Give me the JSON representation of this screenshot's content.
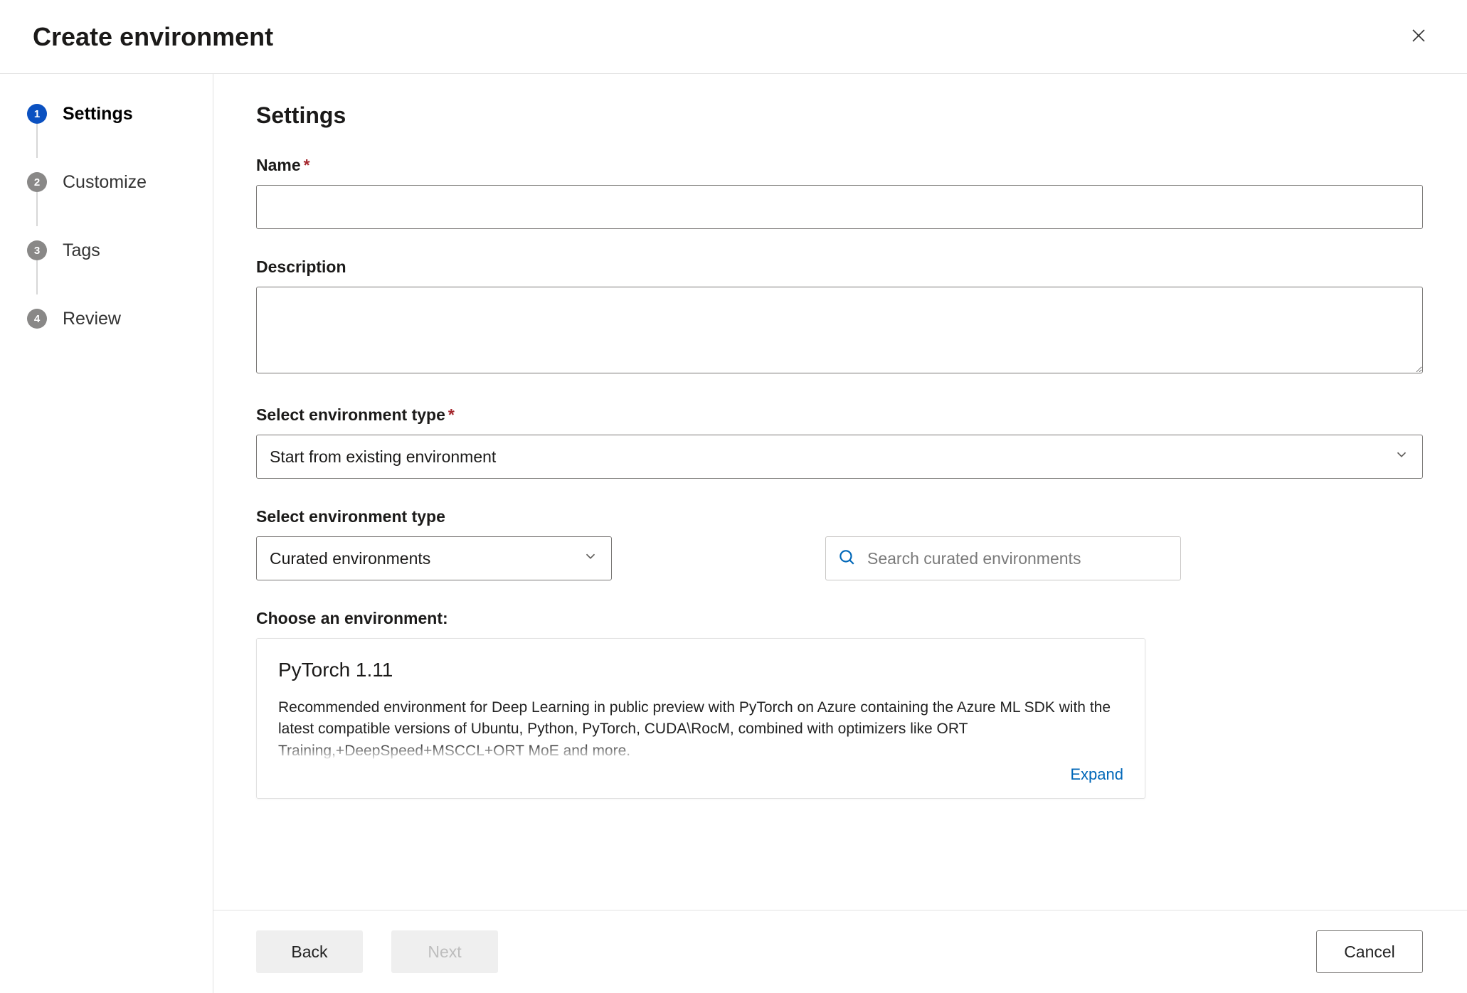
{
  "header": {
    "title": "Create environment"
  },
  "steps": [
    {
      "num": "1",
      "label": "Settings",
      "active": true
    },
    {
      "num": "2",
      "label": "Customize",
      "active": false
    },
    {
      "num": "3",
      "label": "Tags",
      "active": false
    },
    {
      "num": "4",
      "label": "Review",
      "active": false
    }
  ],
  "main": {
    "heading": "Settings",
    "name_label": "Name",
    "name_value": "",
    "desc_label": "Description",
    "desc_value": "",
    "env_type_label": "Select environment type",
    "env_type_value": "Start from existing environment",
    "env_type2_label": "Select environment type",
    "env_type2_value": "Curated environments",
    "search_placeholder": "Search curated environments",
    "choose_label": "Choose an environment:",
    "card": {
      "title": "PyTorch 1.11",
      "desc": "Recommended environment for Deep Learning in public preview with PyTorch on Azure containing the Azure ML SDK with the latest compatible versions of Ubuntu, Python, PyTorch, CUDA\\RocM, combined with optimizers like ORT Training,+DeepSpeed+MSCCL+ORT MoE and more.",
      "expand": "Expand"
    }
  },
  "footer": {
    "back": "Back",
    "next": "Next",
    "cancel": "Cancel"
  }
}
